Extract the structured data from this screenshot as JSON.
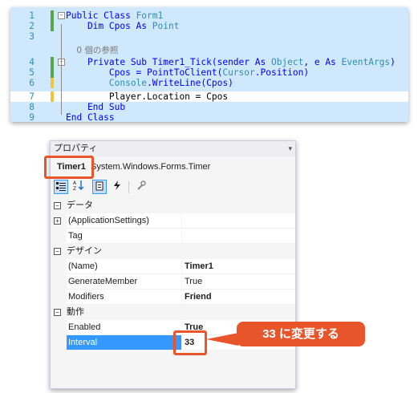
{
  "code": {
    "lines": [
      {
        "num": "1",
        "tokens": [
          {
            "t": "Public Class ",
            "c": "kw"
          },
          {
            "t": "Form1",
            "c": "ty"
          }
        ]
      },
      {
        "num": "2",
        "tokens": [
          {
            "t": "    Dim Cpos As ",
            "c": "kw"
          },
          {
            "t": "Point",
            "c": "ty"
          }
        ]
      },
      {
        "num": "3",
        "tokens": []
      },
      {
        "num": "",
        "tokens": [
          {
            "t": "    0 個の参照",
            "c": "ref"
          }
        ]
      },
      {
        "num": "4",
        "tokens": [
          {
            "t": "    Private Sub Timer1_Tick(sender As ",
            "c": "kw"
          },
          {
            "t": "Object",
            "c": "ty"
          },
          {
            "t": ", e As ",
            "c": "kw"
          },
          {
            "t": "EventArgs",
            "c": "ty"
          },
          {
            "t": ")",
            "c": "kw"
          }
        ]
      },
      {
        "num": "5",
        "tokens": [
          {
            "t": "        Cpos = PointToClient(",
            "c": "kw"
          },
          {
            "t": "Cursor",
            "c": "ty"
          },
          {
            "t": ".Position)",
            "c": "kw"
          }
        ]
      },
      {
        "num": "6",
        "tokens": [
          {
            "t": "        Console",
            "c": "ty"
          },
          {
            "t": ".WriteLine(Cpos)",
            "c": "kw"
          }
        ]
      },
      {
        "num": "7",
        "tokens": [
          {
            "t": "        Player.Location = Cpos",
            "c": "tx"
          }
        ]
      },
      {
        "num": "8",
        "tokens": [
          {
            "t": "    End Sub",
            "c": "kw"
          }
        ]
      },
      {
        "num": "9",
        "tokens": [
          {
            "t": "End Class",
            "c": "kw"
          }
        ]
      }
    ]
  },
  "properties": {
    "title": "プロパティ",
    "object_name": "Timer1",
    "object_type": "System.Windows.Forms.Timer",
    "toolbar_icons": [
      "categorized-icon",
      "alphabetical-icon",
      "properties-icon",
      "events-icon",
      "property-pages-icon"
    ],
    "rows": [
      {
        "kind": "cat",
        "label": "データ",
        "exp": "minus"
      },
      {
        "kind": "prop",
        "label": "(ApplicationSettings)",
        "value": "",
        "exp": "plus",
        "bold": false
      },
      {
        "kind": "prop",
        "label": "Tag",
        "value": "",
        "bold": false
      },
      {
        "kind": "cat",
        "label": "デザイン",
        "exp": "minus"
      },
      {
        "kind": "prop",
        "label": "(Name)",
        "value": "Timer1",
        "bold": true
      },
      {
        "kind": "prop",
        "label": "GenerateMember",
        "value": "True",
        "bold": false
      },
      {
        "kind": "prop",
        "label": "Modifiers",
        "value": "Friend",
        "bold": true
      },
      {
        "kind": "cat",
        "label": "動作",
        "exp": "minus"
      },
      {
        "kind": "prop",
        "label": "Enabled",
        "value": "True",
        "bold": true
      },
      {
        "kind": "prop",
        "label": "Interval",
        "value": "33",
        "bold": true,
        "selected": true
      }
    ]
  },
  "callout": {
    "text": "33 に変更する",
    "color": "#e8552b"
  }
}
